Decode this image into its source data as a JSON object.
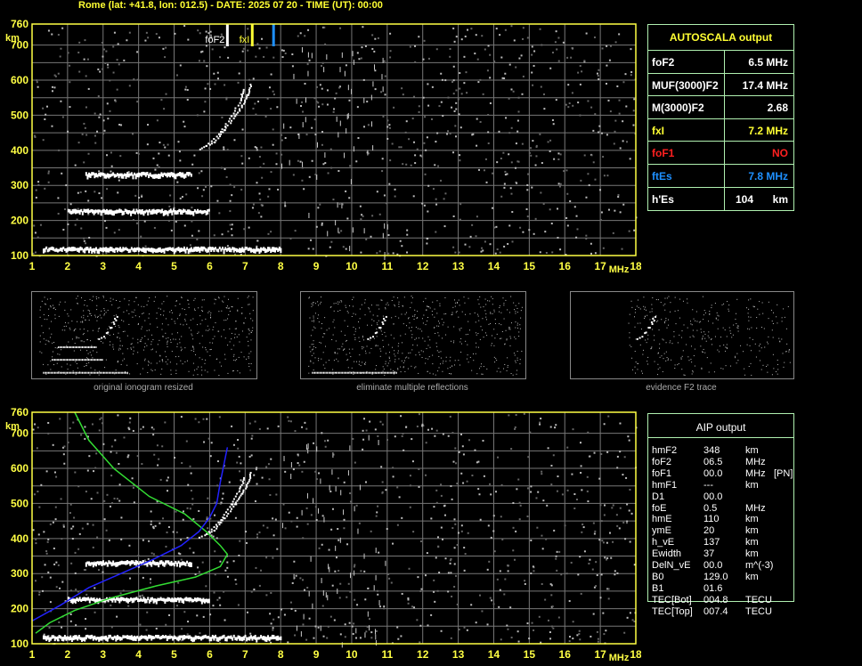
{
  "header": "Rome (lat: +41.8, lon: 012.5) - DATE: 2025 07 20 - TIME (UT): 00:00",
  "colors": {
    "axis": "#ffff44",
    "grid": "#777777",
    "panel_border": "#b0f0b0",
    "trace": "#ffffff",
    "noise": "#bbbbbb",
    "profile_green": "#33dd33",
    "profile_blue": "#2222ff",
    "marker_foF2": "#ffffff",
    "marker_fxI": "#ffff33",
    "marker_ftEs": "#1e90ff"
  },
  "chart_data": [
    {
      "type": "scatter",
      "name": "ionogram",
      "x_unit": "MHz",
      "y_unit": "km",
      "xlim": [
        1,
        18
      ],
      "ylim": [
        100,
        760
      ],
      "x_ticks": [
        "1",
        "2",
        "3",
        "4",
        "5",
        "6",
        "7",
        "8",
        "9",
        "10",
        "11",
        "12",
        "13",
        "14",
        "15",
        "16",
        "17",
        "18"
      ],
      "y_ticks": [
        "100",
        "200",
        "300",
        "400",
        "500",
        "600",
        "700",
        "760"
      ],
      "grid": true,
      "markers": [
        {
          "label": "foF2",
          "x": 6.5,
          "color": "#ffffff"
        },
        {
          "label": "fxI",
          "x": 7.2,
          "color": "#ffff33"
        },
        {
          "label": "",
          "x": 7.8,
          "color": "#1e90ff"
        }
      ],
      "traces": [
        {
          "role": "Es layer",
          "x_start": 1.3,
          "x_end": 8.0,
          "y": 117
        },
        {
          "role": "2Es",
          "x_start": 2.0,
          "x_end": 6.0,
          "y": 225
        },
        {
          "role": "3Es",
          "x_start": 2.5,
          "x_end": 5.5,
          "y": 330
        },
        {
          "role": "F2 trace",
          "points": [
            [
              5.7,
              405
            ],
            [
              6.1,
              425
            ],
            [
              6.4,
              460
            ],
            [
              6.7,
              500
            ],
            [
              6.9,
              530
            ],
            [
              7.05,
              560
            ],
            [
              7.15,
              590
            ]
          ]
        },
        {
          "role": "F2 second hop",
          "points": [
            [
              5.9,
              415
            ],
            [
              6.3,
              455
            ],
            [
              6.6,
              500
            ],
            [
              6.85,
              545
            ],
            [
              6.95,
              575
            ]
          ]
        }
      ]
    },
    {
      "type": "line",
      "name": "ionogram with profile",
      "x_unit": "MHz",
      "y_unit": "km",
      "xlim": [
        1,
        18
      ],
      "ylim": [
        100,
        760
      ],
      "x_ticks": [
        "1",
        "2",
        "3",
        "4",
        "5",
        "6",
        "7",
        "8",
        "9",
        "10",
        "11",
        "12",
        "13",
        "14",
        "15",
        "16",
        "17",
        "18"
      ],
      "y_ticks": [
        "100",
        "200",
        "300",
        "400",
        "500",
        "600",
        "700",
        "760"
      ],
      "grid": true,
      "series": [
        {
          "color": "#33dd33",
          "points": [
            [
              2.2,
              760
            ],
            [
              2.6,
              680
            ],
            [
              3.3,
              600
            ],
            [
              4.3,
              520
            ],
            [
              5.3,
              470
            ],
            [
              5.9,
              420
            ],
            [
              6.3,
              380
            ],
            [
              6.5,
              355
            ],
            [
              6.3,
              320
            ],
            [
              5.6,
              290
            ],
            [
              4.5,
              265
            ],
            [
              3.2,
              230
            ],
            [
              2.2,
              195
            ],
            [
              1.5,
              160
            ],
            [
              1.1,
              130
            ]
          ]
        },
        {
          "color": "#2222ff",
          "points": [
            [
              1.0,
              165
            ],
            [
              1.8,
              210
            ],
            [
              2.6,
              260
            ],
            [
              3.5,
              300
            ],
            [
              4.4,
              340
            ],
            [
              5.2,
              380
            ],
            [
              5.7,
              420
            ],
            [
              6.0,
              460
            ],
            [
              6.2,
              500
            ],
            [
              6.3,
              560
            ],
            [
              6.5,
              660
            ]
          ]
        }
      ]
    }
  ],
  "autoscala": {
    "title": "AUTOSCALA output",
    "rows": [
      {
        "label": "foF2",
        "value": "6.5 MHz",
        "color": "#ffffff"
      },
      {
        "label": "MUF(3000)F2",
        "value": "17.4 MHz",
        "color": "#ffffff"
      },
      {
        "label": "M(3000)F2",
        "value": "2.68",
        "color": "#ffffff"
      },
      {
        "label": "fxI",
        "value": "7.2 MHz",
        "color": "#ffff33"
      },
      {
        "label": "foF1",
        "value": "NO",
        "color": "#ff2020"
      },
      {
        "label": "ftEs",
        "value": "7.8 MHz",
        "color": "#1e90ff"
      },
      {
        "label": "h'Es",
        "value": "104",
        "unit": "km",
        "color": "#ffffff"
      }
    ]
  },
  "thumbnails": [
    {
      "caption": "original ionogram resized"
    },
    {
      "caption": "eliminate multiple reflections"
    },
    {
      "caption": "evidence F2 trace"
    }
  ],
  "aip": {
    "title": "AIP output",
    "rows": [
      {
        "name": "hmF2",
        "value": "348",
        "unit": "km",
        "extra": ""
      },
      {
        "name": "foF2",
        "value": "06.5",
        "unit": "MHz",
        "extra": ""
      },
      {
        "name": "foF1",
        "value": "00.0",
        "unit": "MHz",
        "extra": "[PN]"
      },
      {
        "name": "hmF1",
        "value": "---",
        "unit": "km",
        "extra": ""
      },
      {
        "name": "D1",
        "value": "00.0",
        "unit": "",
        "extra": ""
      },
      {
        "name": "foE",
        "value": "0.5",
        "unit": "MHz",
        "extra": ""
      },
      {
        "name": "hmE",
        "value": "110",
        "unit": "km",
        "extra": ""
      },
      {
        "name": "ymE",
        "value": "20",
        "unit": "km",
        "extra": ""
      },
      {
        "name": "h_vE",
        "value": "137",
        "unit": "km",
        "extra": ""
      },
      {
        "name": "Ewidth",
        "value": "37",
        "unit": "km",
        "extra": ""
      },
      {
        "name": "DelN_vE",
        "value": "00.0",
        "unit": "m^(-3)",
        "extra": ""
      },
      {
        "name": "B0",
        "value": "129.0",
        "unit": "km",
        "extra": ""
      },
      {
        "name": "B1",
        "value": "01.6",
        "unit": "",
        "extra": ""
      },
      {
        "name": "TEC[Bot]",
        "value": "004.8",
        "unit": "TECU",
        "extra": ""
      },
      {
        "name": "TEC[Top]",
        "value": "007.4",
        "unit": "TECU",
        "extra": ""
      }
    ]
  }
}
